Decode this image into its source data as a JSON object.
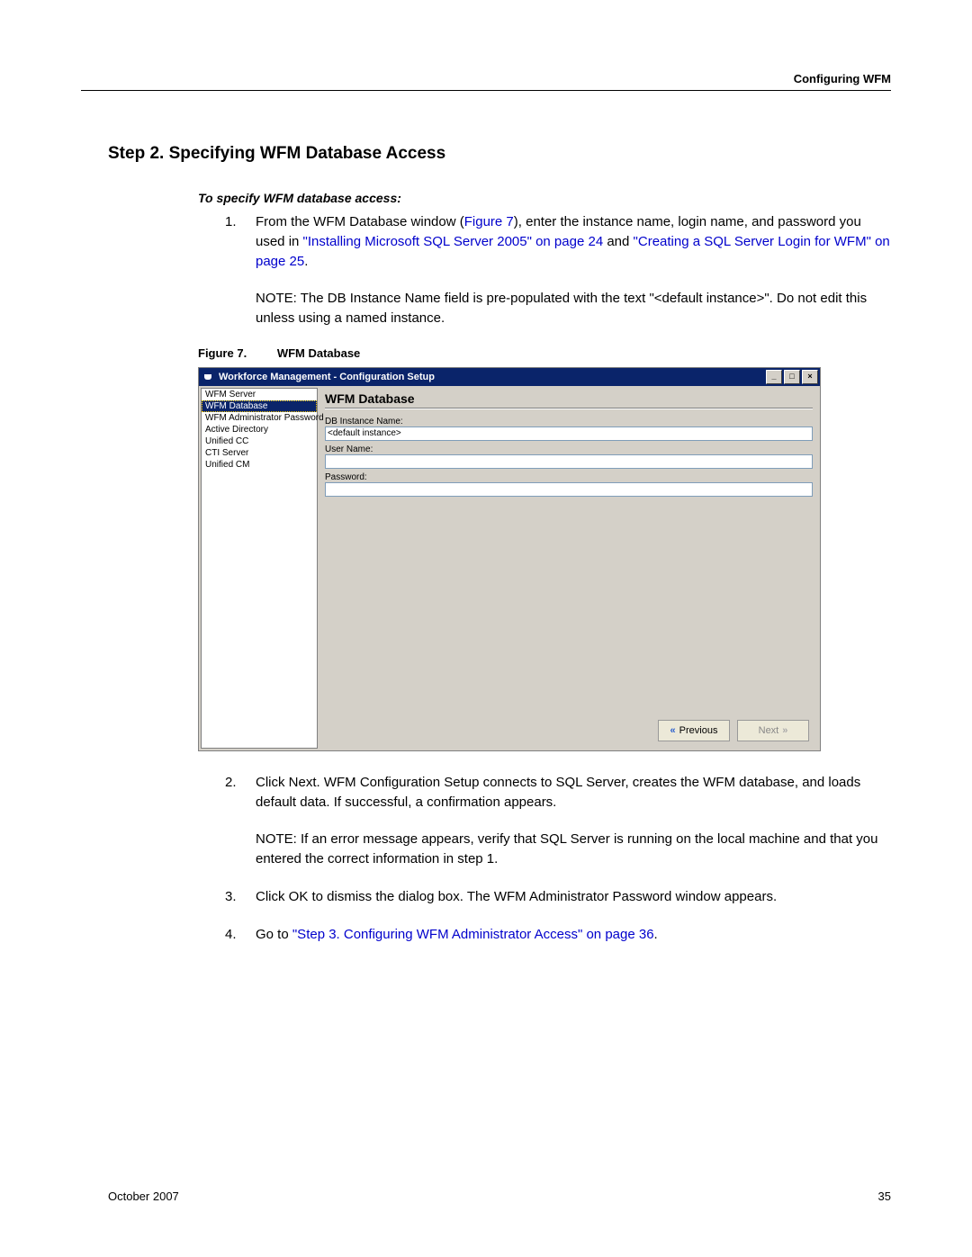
{
  "header": {
    "section": "Configuring WFM"
  },
  "title": "Step 2. Specifying WFM Database Access",
  "subhead": "To specify WFM database access:",
  "steps": {
    "s1_num": "1.",
    "s1_a": "From the WFM Database window (",
    "s1_figref": "Figure 7",
    "s1_b": "), enter the instance name, login name, and password you used in ",
    "s1_link1": "\"Installing Microsoft SQL Server 2005\" on page 24",
    "s1_c": " and ",
    "s1_link2": "\"Creating a SQL Server Login for WFM\" on page 25",
    "s1_d": ".",
    "note1_label": "NOTE:",
    "note1_text": "  The DB Instance Name field is pre-populated with the text \"<default instance>\". Do not edit this unless using a named instance.",
    "s2_num": "2.",
    "s2_text": "Click Next. WFM Configuration Setup connects to SQL Server, creates the WFM database, and loads default data. If successful, a confirmation appears.",
    "note2_label": "NOTE:",
    "note2_text": "  If an error message appears, verify that SQL Server is running on the local machine and that you entered the correct information in step 1.",
    "s3_num": "3.",
    "s3_text": "Click OK to dismiss the dialog box. The WFM Administrator Password window appears.",
    "s4_num": "4.",
    "s4_a": "Go to ",
    "s4_link": "\"Step 3. Configuring WFM Administrator Access\" on page 36",
    "s4_b": "."
  },
  "figure": {
    "label": "Figure 7.",
    "title": "WFM Database"
  },
  "app": {
    "window_title": "Workforce Management - Configuration Setup",
    "win_min": "_",
    "win_max": "□",
    "win_close": "×",
    "sidebar": {
      "items": [
        "WFM Server",
        "WFM Database",
        "WFM Administrator Password",
        "Active Directory",
        "Unified CC",
        "CTI Server",
        "Unified CM"
      ],
      "selected_index": 1
    },
    "panel_title": "WFM Database",
    "fields": {
      "db_label": "DB Instance Name:",
      "db_value": "<default instance>",
      "user_label": "User Name:",
      "user_value": "",
      "pass_label": "Password:",
      "pass_value": ""
    },
    "buttons": {
      "previous": "Previous",
      "next": "Next"
    }
  },
  "footer": {
    "date": "October 2007",
    "page": "35"
  }
}
